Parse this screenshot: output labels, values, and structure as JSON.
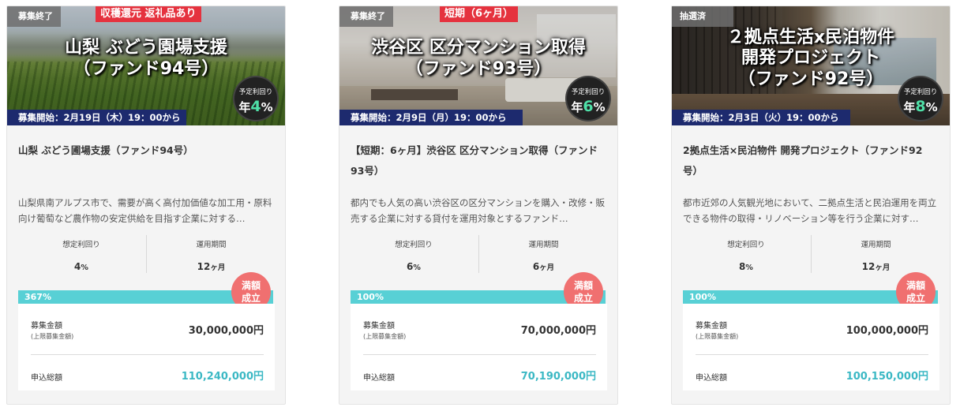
{
  "funds": [
    {
      "status": "募集終了",
      "tag": "収穫還元 返礼品あり",
      "hero_title_line1": "山梨 ぶどう園場支援",
      "hero_title_line2": "（ファンド94号）",
      "start": "募集開始：2月19日（木）19：00から",
      "rate_label": "予定利回り",
      "rate_prefix": "年",
      "rate_value": "4",
      "rate_suffix": "%",
      "title": "山梨 ぶどう圃場支援（ファンド94号）",
      "description": "山梨県南アルプス市で、需要が高く高付加価値な加工用・原料向け葡萄など農作物の安定供給を目指す企業に対する…",
      "stat_yield_label": "想定利回り",
      "stat_yield_value": "4",
      "stat_yield_unit": "%",
      "stat_period_label": "運用期間",
      "stat_period_value": "12",
      "stat_period_unit": "ヶ月",
      "progress_text": "367%",
      "progress_percent": 100,
      "badge_line1": "満額",
      "badge_line2": "成立",
      "amount_label": "募集金額",
      "amount_sub": "(上限募集金額)",
      "amount_value": "30,000,000円",
      "total_label": "申込総額",
      "total_value": "110,240,000円"
    },
    {
      "status": "募集終了",
      "tag": "短期（6ヶ月）",
      "hero_title_line1": "渋谷区 区分マンション取得",
      "hero_title_line2": "（ファンド93号）",
      "start": "募集開始：2月9日（月）19：00から",
      "rate_label": "予定利回り",
      "rate_prefix": "年",
      "rate_value": "6",
      "rate_suffix": "%",
      "title": "【短期：6ヶ月】渋谷区 区分マンション取得（ファンド93号）",
      "description": "都内でも人気の高い渋谷区の区分マンションを購入・改修・販売する企業に対する貸付を運用対象とするファンド…",
      "stat_yield_label": "想定利回り",
      "stat_yield_value": "6",
      "stat_yield_unit": "%",
      "stat_period_label": "運用期間",
      "stat_period_value": "6",
      "stat_period_unit": "ヶ月",
      "progress_text": "100%",
      "progress_percent": 100,
      "badge_line1": "満額",
      "badge_line2": "成立",
      "amount_label": "募集金額",
      "amount_sub": "(上限募集金額)",
      "amount_value": "70,000,000円",
      "total_label": "申込総額",
      "total_value": "70,190,000円"
    },
    {
      "status": "抽選済",
      "tag": "",
      "hero_title_line1": "２拠点生活x民泊物件",
      "hero_title_line2": "開発プロジェクト",
      "hero_title_line3": "（ファンド92号）",
      "start": "募集開始：2月3日（火）19：00から",
      "rate_label": "予定利回り",
      "rate_prefix": "年",
      "rate_value": "8",
      "rate_suffix": "%",
      "title": "2拠点生活×民泊物件 開発プロジェクト（ファンド92号）",
      "description": "都市近郊の人気観光地において、二拠点生活と民泊運用を両立できる物件の取得・リノベーション等を行う企業に対す…",
      "stat_yield_label": "想定利回り",
      "stat_yield_value": "8",
      "stat_yield_unit": "%",
      "stat_period_label": "運用期間",
      "stat_period_value": "12",
      "stat_period_unit": "ヶ月",
      "progress_text": "100%",
      "progress_percent": 100,
      "badge_line1": "満額",
      "badge_line2": "成立",
      "amount_label": "募集金額",
      "amount_sub": "(上限募集金額)",
      "amount_value": "100,000,000円",
      "total_label": "申込総額",
      "total_value": "100,150,000円"
    }
  ],
  "colors": {
    "accent_teal": "#58d0d5",
    "total_teal": "#3bb8c4",
    "badge_red": "#f07070",
    "tag_red": "#e5323e",
    "start_bar_navy": "#1d2a6e",
    "rate_green": "#4fe0a8"
  }
}
